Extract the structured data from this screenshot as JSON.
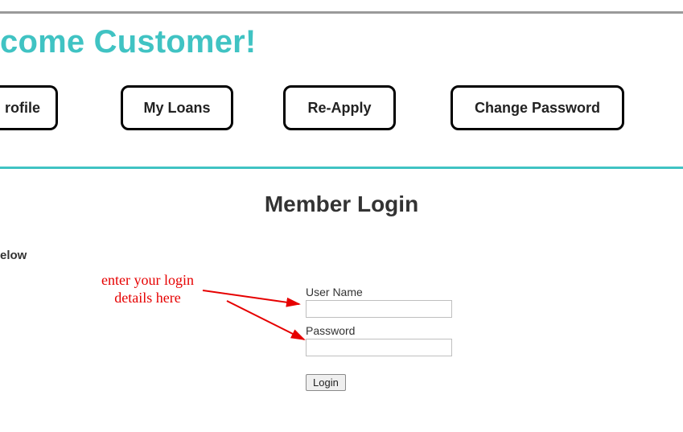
{
  "header": {
    "title_fragment": "come Customer!"
  },
  "nav": {
    "profile": "rofile",
    "loans": "My Loans",
    "reapply": "Re-Apply",
    "changepw": "Change Password"
  },
  "login": {
    "heading": "Member Login",
    "instr_left": "elow",
    "user_label": "User Name",
    "pass_label": "Password",
    "user_value": "",
    "pass_value": "",
    "submit": "Login"
  },
  "annotation": {
    "line1": "enter your login",
    "line2": "details here"
  },
  "colors": {
    "accent": "#40c3c3",
    "annotation": "#e60000"
  }
}
